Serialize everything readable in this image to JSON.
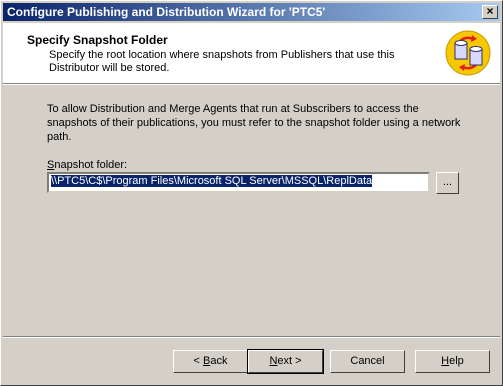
{
  "window": {
    "title": "Configure Publishing and Distribution Wizard for 'PTC5'",
    "close_glyph": "×"
  },
  "header": {
    "title": "Specify Snapshot Folder",
    "subtitle": "Specify the root location where snapshots from Publishers that use this Distributor will be stored.",
    "icon": "wizard-database-icon"
  },
  "body": {
    "info": "To allow Distribution and Merge Agents that run at Subscribers to access the snapshots of their publications, you must refer to the snapshot folder using a network path.",
    "snapshot_label_accel": "S",
    "snapshot_label_rest": "napshot folder:",
    "snapshot_value": "\\\\PTC5\\C$\\Program Files\\Microsoft SQL Server\\MSSQL\\ReplData",
    "browse_label": "..."
  },
  "buttons": {
    "back_prefix": "< ",
    "back_accel": "B",
    "back_rest": "ack",
    "next_accel": "N",
    "next_rest": "ext >",
    "cancel": "Cancel",
    "help_accel": "H",
    "help_rest": "elp"
  },
  "colors": {
    "titlebar_start": "#0a246a",
    "titlebar_end": "#a6caf0",
    "selection": "#0a246a",
    "face": "#d4d0c8"
  }
}
